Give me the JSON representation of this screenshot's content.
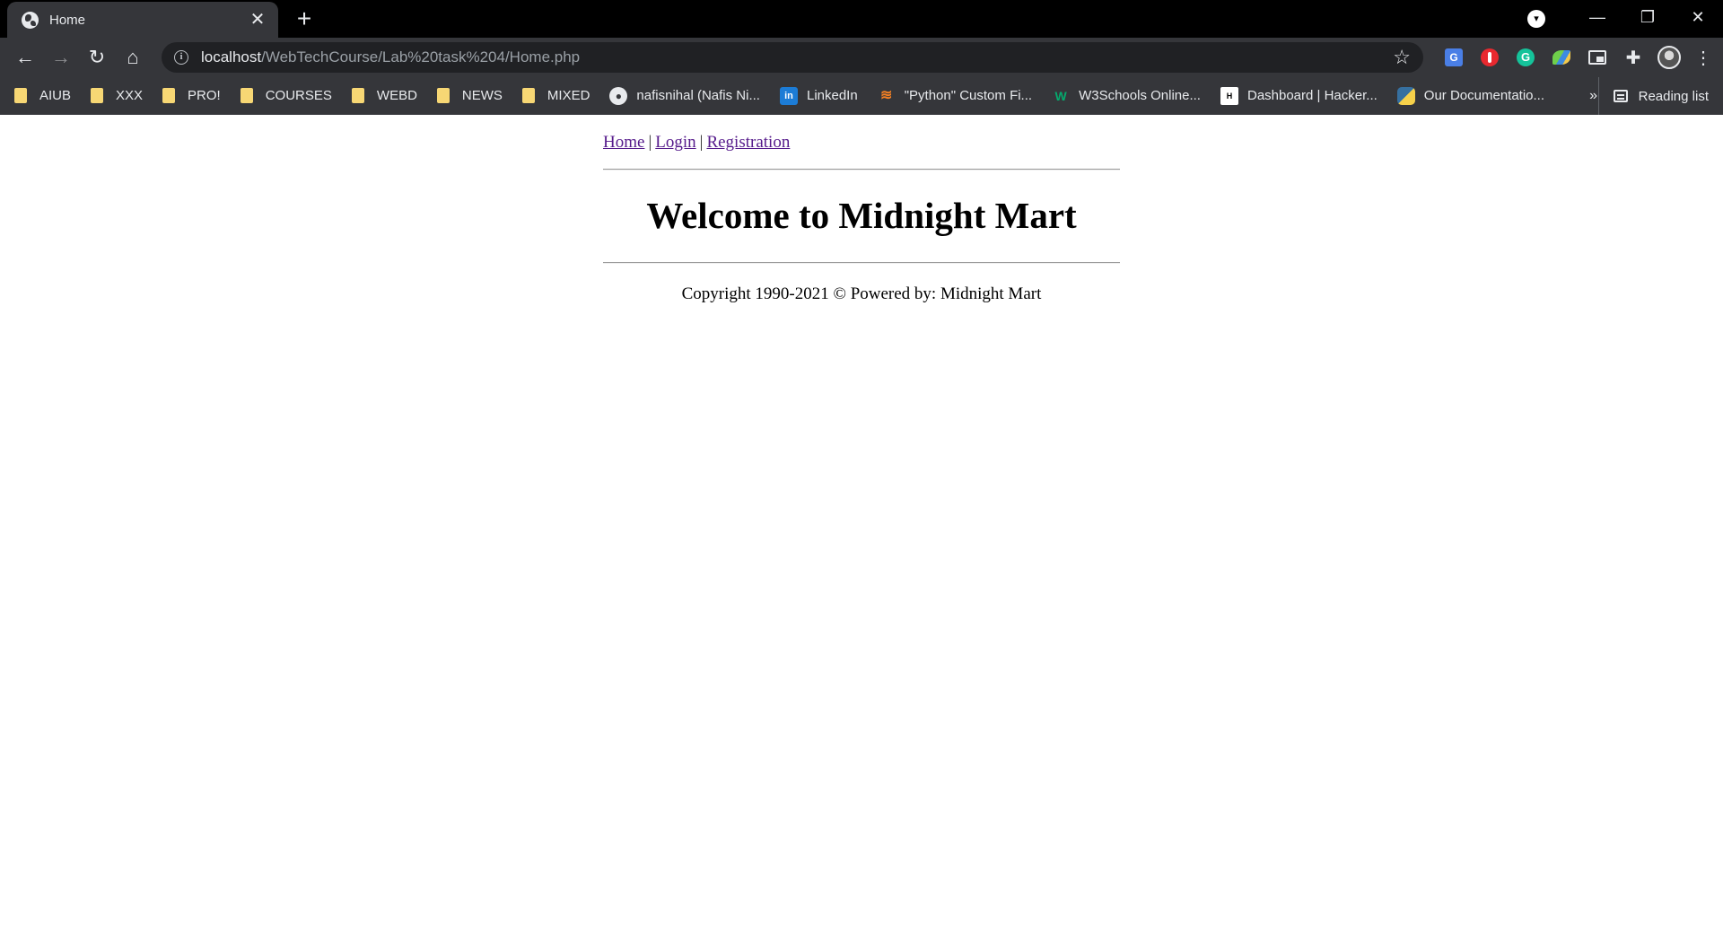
{
  "browser": {
    "tab": {
      "title": "Home",
      "close_glyph": "✕"
    },
    "new_tab_glyph": "+",
    "window_controls": {
      "minimize": "—",
      "restore": "❐",
      "close": "✕"
    },
    "nav": {
      "back": "←",
      "forward": "→",
      "reload": "↻",
      "home": "⌂"
    },
    "url": {
      "host": "localhost",
      "path": "/WebTechCourse/Lab%20task%204/Home.php"
    },
    "star_glyph": "☆",
    "menu_glyph": "⋮",
    "extensions": {
      "translate": "G",
      "grammarly": "G",
      "puzzle_glyph": "✚"
    },
    "bookmarks": [
      {
        "label": "AIUB",
        "type": "folder"
      },
      {
        "label": "XXX",
        "type": "folder"
      },
      {
        "label": "PRO!",
        "type": "folder"
      },
      {
        "label": "COURSES",
        "type": "folder"
      },
      {
        "label": "WEBD",
        "type": "folder"
      },
      {
        "label": "NEWS",
        "type": "folder"
      },
      {
        "label": "MIXED",
        "type": "folder"
      },
      {
        "label": "nafisnihal (Nafis Ni...",
        "type": "github"
      },
      {
        "label": "LinkedIn",
        "type": "linkedin"
      },
      {
        "label": "\"Python\" Custom Fi...",
        "type": "stackoverflow"
      },
      {
        "label": "W3Schools Online...",
        "type": "w3schools"
      },
      {
        "label": "Dashboard | Hacker...",
        "type": "hackerrank"
      },
      {
        "label": "Our Documentatio...",
        "type": "python"
      }
    ],
    "bookmark_icons": {
      "linkedin": "in",
      "w3schools": "W",
      "hackerrank": "H",
      "stackoverflow": "≋"
    },
    "bookmark_overflow": "»",
    "reading_list": "Reading list"
  },
  "page": {
    "nav": {
      "home": "Home",
      "login": "Login",
      "registration": "Registration",
      "separator": "|"
    },
    "heading": "Welcome to Midnight Mart",
    "footer": "Copyright 1990-2021 © Powered by: Midnight Mart"
  },
  "colors": {
    "link_visited": "#551a8b",
    "chrome_dark": "#202124",
    "chrome_toolbar": "#35363a"
  }
}
